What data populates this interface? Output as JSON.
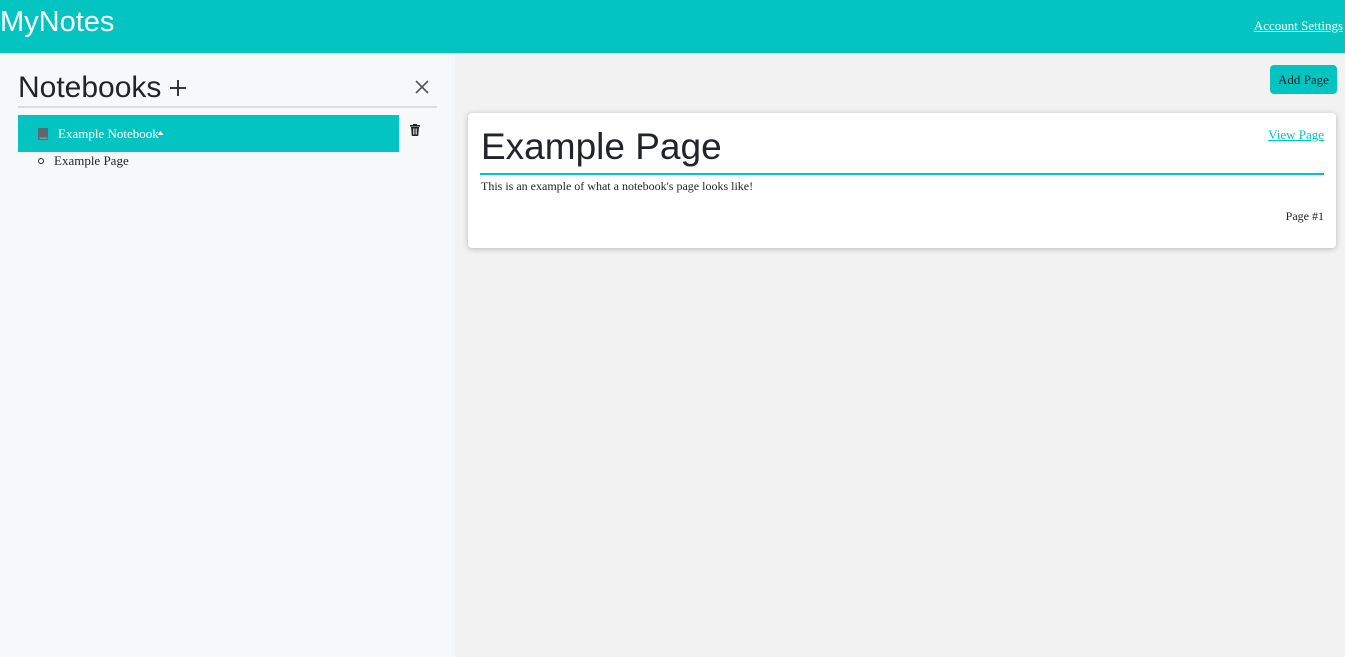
{
  "header": {
    "brand": "MyNotes",
    "account_settings": "Account Settings"
  },
  "sidebar": {
    "title": "Notebooks",
    "add_icon": "plus-icon",
    "close_icon": "close-icon",
    "notebooks": [
      {
        "label": "Example Notebook",
        "icon": "book-icon",
        "expanded_icon": "caret-up-icon",
        "delete_icon": "trash-icon",
        "pages": [
          "Example Page"
        ]
      }
    ]
  },
  "main": {
    "add_page_label": "Add Page",
    "pages": [
      {
        "title": "Example Page",
        "view_label": "View Page",
        "body": "This is an example of what a notebook's page looks like!",
        "page_number": "Page #1"
      }
    ]
  },
  "colors": {
    "accent": "#03c4c1",
    "sidebar_bg": "#f7f8fa",
    "main_bg": "#f2f2f2"
  }
}
